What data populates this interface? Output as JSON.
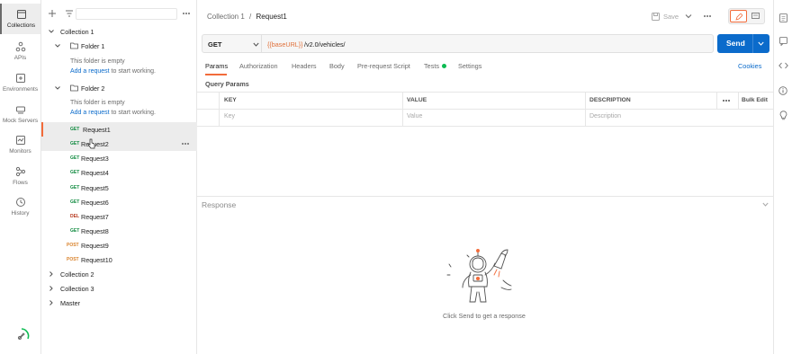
{
  "rail": {
    "items": [
      {
        "label": "Collections"
      },
      {
        "label": "APIs"
      },
      {
        "label": "Environments"
      },
      {
        "label": "Mock Servers"
      },
      {
        "label": "Monitors"
      },
      {
        "label": "Flows"
      },
      {
        "label": "History"
      }
    ]
  },
  "sidebar": {
    "tree": {
      "collection1": "Collection 1",
      "folder1": "Folder 1",
      "folder1_empty": "This folder is empty",
      "folder1_link": "Add a request",
      "folder1_after": " to start working.",
      "folder2": "Folder 2",
      "folder2_empty": "This folder is empty",
      "folder2_link": "Add a request",
      "folder2_after": " to start working.",
      "requests": [
        {
          "method": "GET",
          "name": "Request1"
        },
        {
          "method": "GET",
          "name": "Request2"
        },
        {
          "method": "GET",
          "name": "Request3"
        },
        {
          "method": "GET",
          "name": "Request4"
        },
        {
          "method": "GET",
          "name": "Request5"
        },
        {
          "method": "GET",
          "name": "Request6"
        },
        {
          "method": "DEL",
          "name": "Request7"
        },
        {
          "method": "GET",
          "name": "Request8"
        },
        {
          "method": "POST",
          "name": "Request9"
        },
        {
          "method": "POST",
          "name": "Request10"
        }
      ],
      "collection2": "Collection 2",
      "collection3": "Collection 3",
      "master": "Master"
    }
  },
  "header": {
    "breadcrumb_parent": "Collection 1",
    "breadcrumb_sep": "/",
    "breadcrumb_current": "Request1",
    "save_label": "Save"
  },
  "request": {
    "method": "GET",
    "url_var": "{{baseURL}}",
    "url_path": "/v2.0/vehicles/",
    "send_label": "Send"
  },
  "tabs": {
    "params": "Params",
    "authorization": "Authorization",
    "headers": "Headers",
    "body": "Body",
    "prerequest": "Pre-request Script",
    "tests": "Tests",
    "settings": "Settings",
    "cookies": "Cookies"
  },
  "params": {
    "title": "Query Params",
    "columns": {
      "key": "KEY",
      "value": "VALUE",
      "description": "DESCRIPTION"
    },
    "bulk_edit": "Bulk Edit",
    "placeholders": {
      "key": "Key",
      "value": "Value",
      "description": "Description"
    }
  },
  "response": {
    "title": "Response",
    "empty_text": "Click Send to get a response"
  },
  "colors": {
    "send": "#0b6bcb",
    "active_tab": "#f26b3a",
    "tests_dot": "#0cbb52",
    "url_var": "#e0703a"
  }
}
